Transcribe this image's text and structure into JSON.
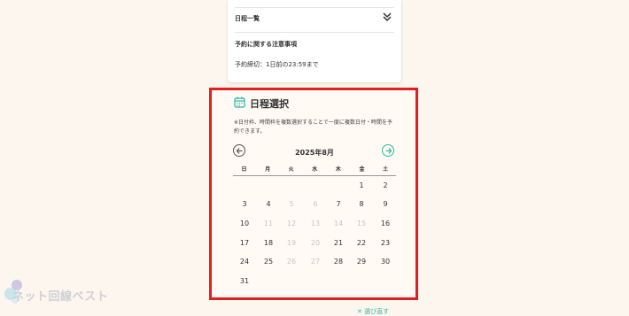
{
  "info": {
    "schedule_list_label": "日程一覧",
    "notes_title": "予約に関する注意事項",
    "notes_text": "予約締切：1日前の23:59まで"
  },
  "calendar": {
    "title": "日程選択",
    "note": "※日付枠、時間枠を複数選択することで一度に複数日付・時間を予約できます。",
    "month_label": "2025年8月",
    "weekdays": [
      "日",
      "月",
      "火",
      "水",
      "木",
      "金",
      "土"
    ],
    "weeks": [
      [
        null,
        null,
        null,
        null,
        null,
        {
          "d": "1",
          "on": true
        },
        {
          "d": "2",
          "on": true
        }
      ],
      [
        {
          "d": "3",
          "on": true
        },
        {
          "d": "4",
          "on": true
        },
        {
          "d": "5",
          "on": false
        },
        {
          "d": "6",
          "on": false
        },
        {
          "d": "7",
          "on": true
        },
        {
          "d": "8",
          "on": true
        },
        {
          "d": "9",
          "on": true
        }
      ],
      [
        {
          "d": "10",
          "on": true
        },
        {
          "d": "11",
          "on": false
        },
        {
          "d": "12",
          "on": false
        },
        {
          "d": "13",
          "on": false
        },
        {
          "d": "14",
          "on": false
        },
        {
          "d": "15",
          "on": false
        },
        {
          "d": "16",
          "on": true
        }
      ],
      [
        {
          "d": "17",
          "on": true
        },
        {
          "d": "18",
          "on": true
        },
        {
          "d": "19",
          "on": false
        },
        {
          "d": "20",
          "on": false
        },
        {
          "d": "21",
          "on": true
        },
        {
          "d": "22",
          "on": true
        },
        {
          "d": "23",
          "on": true
        }
      ],
      [
        {
          "d": "24",
          "on": true
        },
        {
          "d": "25",
          "on": true
        },
        {
          "d": "26",
          "on": false
        },
        {
          "d": "27",
          "on": false
        },
        {
          "d": "28",
          "on": true
        },
        {
          "d": "29",
          "on": true
        },
        {
          "d": "30",
          "on": true
        }
      ],
      [
        {
          "d": "31",
          "on": true
        },
        null,
        null,
        null,
        null,
        null,
        null
      ]
    ]
  },
  "reset_label": "✕ 選び直す",
  "watermark": "ネット回線ベスト",
  "colors": {
    "accent": "#2bb7a8",
    "highlight": "#e0201e",
    "background": "#fdf6ee"
  }
}
